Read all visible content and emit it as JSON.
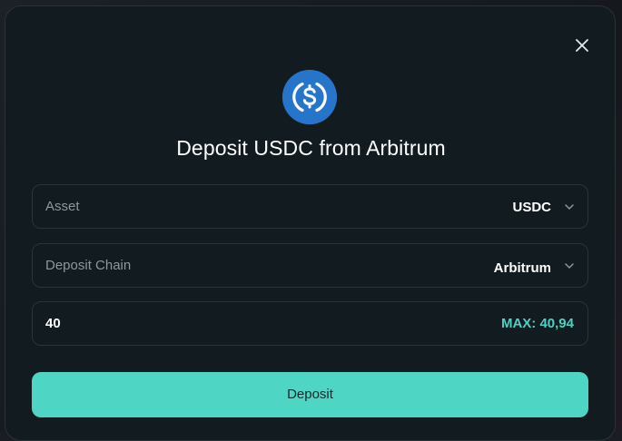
{
  "modal": {
    "title": "Deposit USDC from Arbitrum",
    "coin_icon": "usdc-coin-icon",
    "close_icon": "close-icon"
  },
  "asset_field": {
    "label": "Asset",
    "value": "USDC"
  },
  "chain_field": {
    "label": "Deposit Chain",
    "value": "Arbitrum"
  },
  "amount_field": {
    "value": "40",
    "max_label": "MAX: 40,94"
  },
  "deposit_button": {
    "label": "Deposit"
  },
  "colors": {
    "modal_bg": "#121b1f",
    "accent": "#4fd5c4",
    "usdc_blue": "#2775ca"
  }
}
